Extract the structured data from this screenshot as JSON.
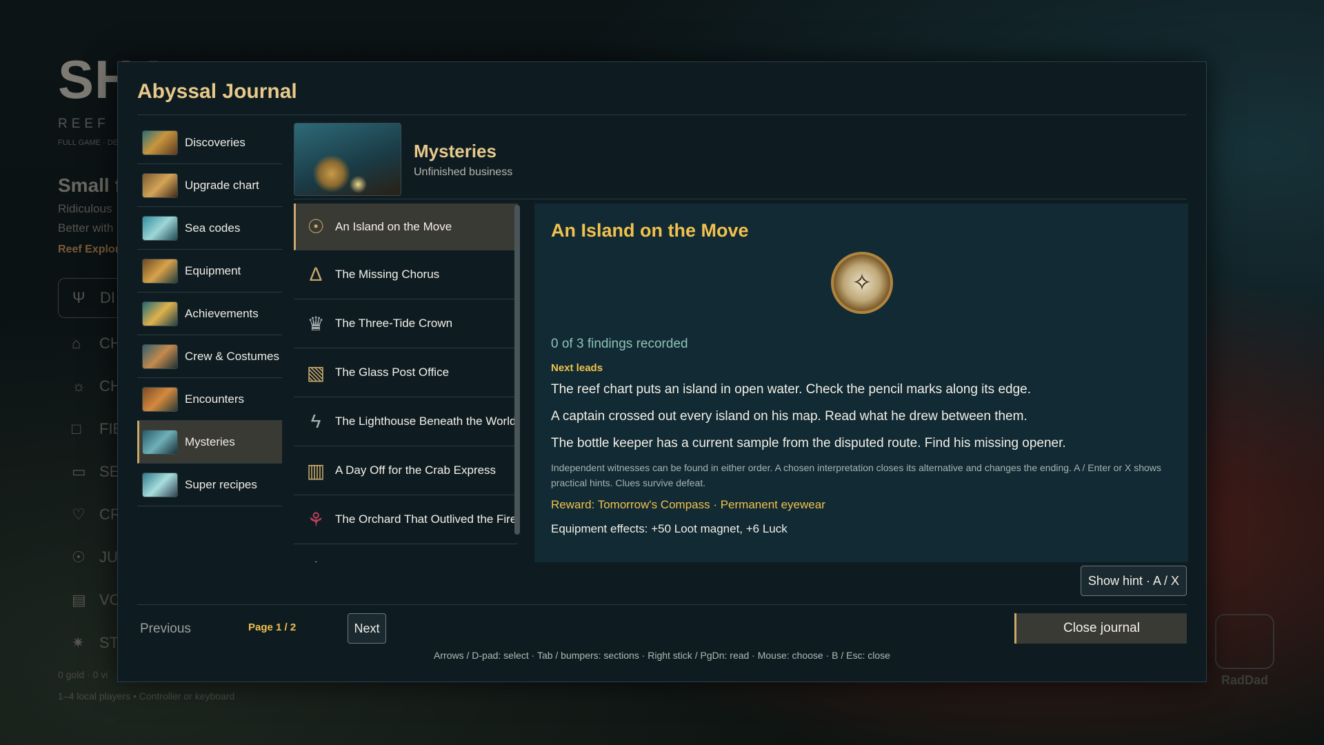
{
  "background": {
    "title": "SHA",
    "subtitle": "REEF RO",
    "small": "FULL GAME · DE",
    "heading": "Small fi",
    "line1": "Ridiculous",
    "line2": "Better with",
    "accent": "Reef Explor",
    "menu": [
      {
        "icon": "Ψ",
        "label": "DI"
      },
      {
        "icon": "⌂",
        "label": "CH"
      },
      {
        "icon": "☼",
        "label": "CH"
      },
      {
        "icon": "□",
        "label": "FIE"
      },
      {
        "icon": "▭",
        "label": "SE"
      },
      {
        "icon": "♡",
        "label": "CR"
      },
      {
        "icon": "☉",
        "label": "JU"
      },
      {
        "icon": "▤",
        "label": "VO"
      },
      {
        "icon": "✷",
        "label": "ST"
      }
    ],
    "footer1": "0 gold  ·  0 vi",
    "footer2": "1–4 local players  •  Controller or keyboard",
    "logo_text": "RadDad"
  },
  "journal": {
    "title": "Abyssal Journal",
    "sidebar": [
      {
        "label": "Discoveries",
        "icon": "discoveries-thumbnail"
      },
      {
        "label": "Upgrade chart",
        "icon": "upgrade-chart-thumbnail"
      },
      {
        "label": "Sea codes",
        "icon": "sea-codes-thumbnail"
      },
      {
        "label": "Equipment",
        "icon": "equipment-thumbnail"
      },
      {
        "label": "Achievements",
        "icon": "achievements-thumbnail"
      },
      {
        "label": "Crew & Costumes",
        "icon": "crew-thumbnail"
      },
      {
        "label": "Encounters",
        "icon": "encounters-thumbnail"
      },
      {
        "label": "Mysteries",
        "icon": "mysteries-thumbnail",
        "active": true
      },
      {
        "label": "Super recipes",
        "icon": "super-recipes-thumbnail"
      }
    ],
    "section": {
      "title": "Mysteries",
      "subtitle": "Unfinished business"
    },
    "entries": [
      {
        "label": "An Island on the Move",
        "icon": "compass-icon",
        "glyph": "☉",
        "active": true
      },
      {
        "label": "The Missing Chorus",
        "icon": "bell-icon",
        "glyph": "∆"
      },
      {
        "label": "The Three-Tide Crown",
        "icon": "crown-icon",
        "glyph": "♛"
      },
      {
        "label": "The Glass Post Office",
        "icon": "map-icon",
        "glyph": "▧"
      },
      {
        "label": "The Lighthouse Beneath the World",
        "icon": "lightning-icon",
        "glyph": "ϟ"
      },
      {
        "label": "A Day Off for the Crab Express",
        "icon": "book-icon",
        "glyph": "▥"
      },
      {
        "label": "The Orchard That Outlived the Fire",
        "icon": "flower-icon",
        "glyph": "⚘"
      }
    ],
    "detail": {
      "title": "An Island on the Move",
      "image": "compass-icon",
      "findings": "0 of 3 findings recorded",
      "next_leads_label": "Next leads",
      "leads": [
        "The reef chart puts an island in open water. Check the pencil marks along its edge.",
        "A captain crossed out every island on his map. Read what he drew between them.",
        "The bottle keeper has a current sample from the disputed route. Find his missing opener."
      ],
      "note": "Independent witnesses can be found in either order. A chosen interpretation closes its alternative and changes the ending. A / Enter or X shows practical hints. Clues survive defeat.",
      "reward": "Reward: Tomorrow's Compass · Permanent eyewear",
      "effects": "Equipment effects: +50 Loot magnet, +6 Luck"
    },
    "hint_button": "Show hint · A / X",
    "previous_label": "Previous",
    "page_indicator": "Page 1 / 2",
    "next_label": "Next",
    "close_label": "Close journal",
    "controls": "Arrows / D-pad: select · Tab / bumpers: sections · Right stick / PgDn: read · Mouse: choose · B / Esc: close"
  }
}
